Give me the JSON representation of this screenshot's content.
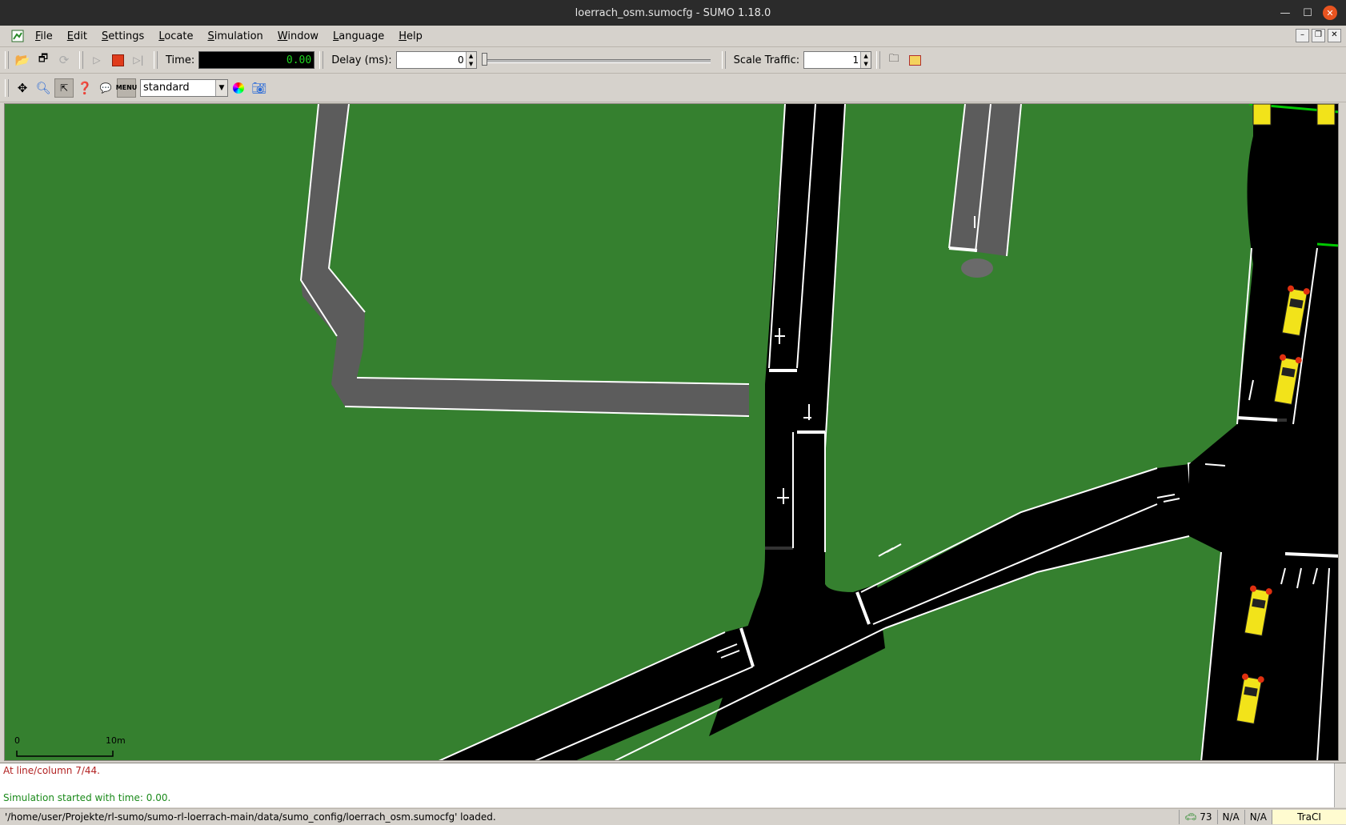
{
  "window": {
    "title": "loerrach_osm.sumocfg - SUMO 1.18.0"
  },
  "menu": [
    {
      "label": "File",
      "accel": "F",
      "rest": "ile"
    },
    {
      "label": "Edit",
      "accel": "E",
      "rest": "dit"
    },
    {
      "label": "Settings",
      "accel": "S",
      "rest": "ettings"
    },
    {
      "label": "Locate",
      "accel": "L",
      "rest": "ocate"
    },
    {
      "label": "Simulation",
      "accel": "S",
      "rest": "imulation"
    },
    {
      "label": "Window",
      "accel": "W",
      "rest": "indow"
    },
    {
      "label": "Language",
      "accel": "L",
      "rest": "anguage"
    },
    {
      "label": "Help",
      "accel": "H",
      "rest": "elp"
    }
  ],
  "toolbar": {
    "time_label": "Time:",
    "time_value": "0.00",
    "delay_label": "Delay (ms):",
    "delay_value": "0",
    "delay_fraction": 0.0,
    "scale_label": "Scale Traffic:",
    "scale_value": "1"
  },
  "view_toolbar": {
    "scheme": "standard"
  },
  "canvas": {
    "scale_bar_start": "0",
    "scale_bar_end": "10m",
    "colors": {
      "grass": "#35802f",
      "road": "#000000",
      "footway": "#5c5c5c",
      "vehicle": "#f2e31a",
      "signal_green": "#00c800"
    }
  },
  "messages": {
    "line1": "At line/column 7/44.",
    "line2": "Simulation started with time: 0.00."
  },
  "status": {
    "path_text": "'/home/user/Projekte/rl-sumo/sumo-rl-loerrach-main/data/sumo_config/loerrach_osm.sumocfg' loaded.",
    "vehicles": "73",
    "cell1": "N/A",
    "cell2": "N/A",
    "traci": "TraCI"
  }
}
